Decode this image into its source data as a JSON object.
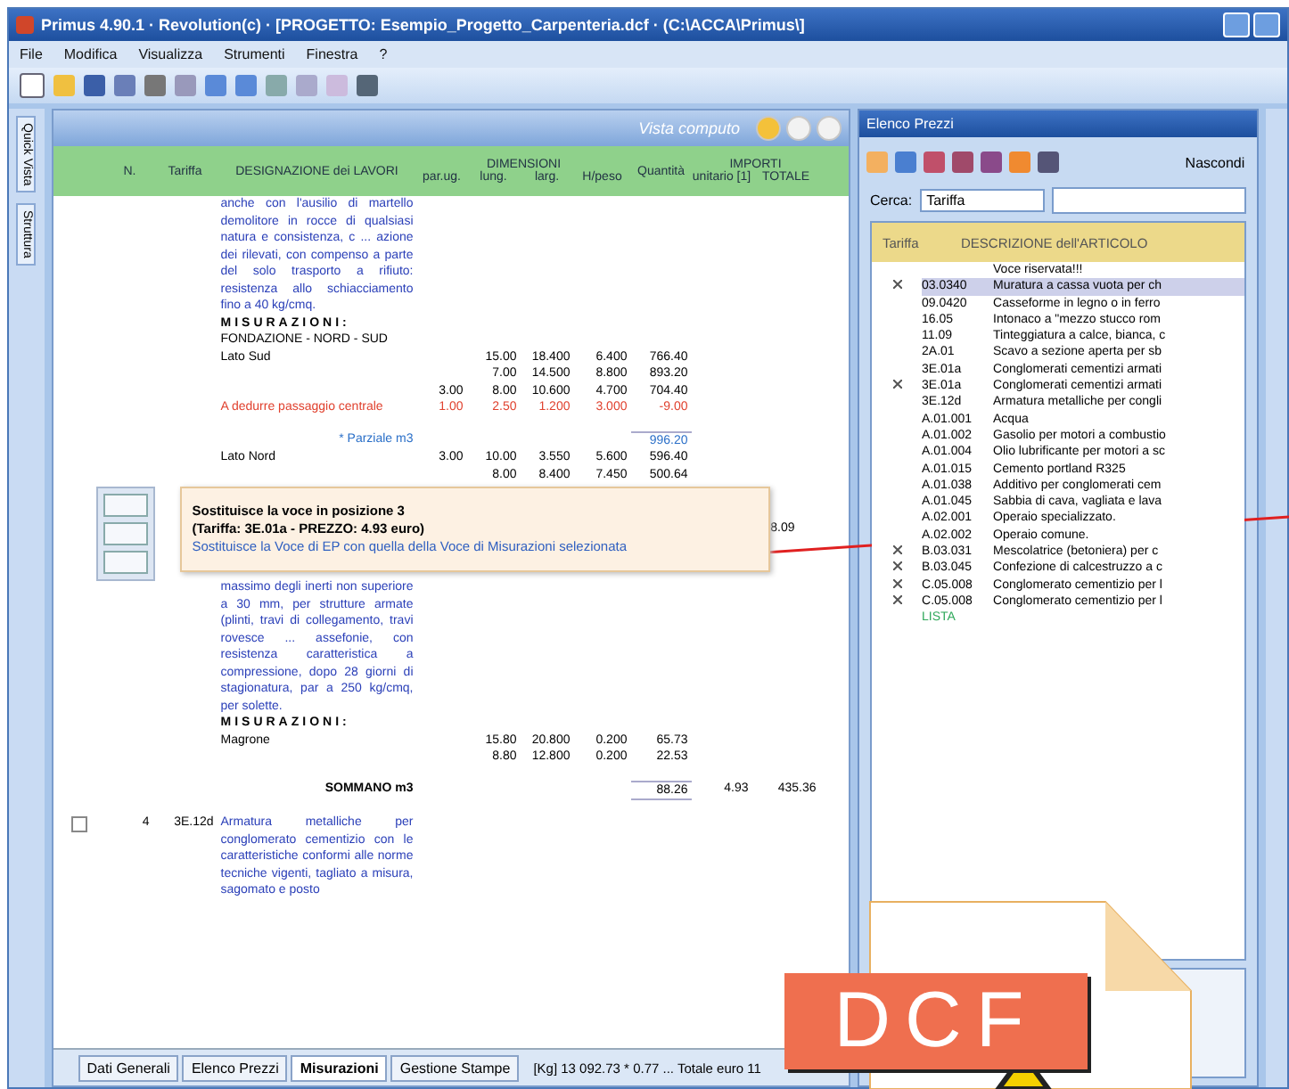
{
  "window": {
    "title": "Primus 4.90.1 · Revolution(c) · [PROGETTO: Esempio_Progetto_Carpenteria.dcf · (C:\\ACCA\\Primus\\]"
  },
  "menu": [
    "File",
    "Modifica",
    "Visualizza",
    "Strumenti",
    "Finestra",
    "?"
  ],
  "side_tabs": [
    "Quick Vista",
    "Struttura"
  ],
  "document": {
    "title": "Vista computo",
    "header": {
      "number": "N.",
      "tariff": "Tariffa",
      "designation": "DESIGNAZIONE dei LAVORI",
      "dimensions": "DIMENSIONI",
      "dim_columns": [
        "par.ug.",
        "lung.",
        "larg.",
        "H/peso"
      ],
      "quantity": "Quantità",
      "amounts": "IMPORTI",
      "amount_columns": [
        "unitario [1]",
        "TOTALE"
      ]
    },
    "rows": [
      {
        "kind": "text",
        "desc": "anche con l'ausilio di martello demolitore in rocce di qualsiasi natura e consistenza, c ... azione dei rilevati, con compenso a parte del solo trasporto a rifiuto: resistenza allo schiacciamento fino a 40 kg/cmq."
      },
      {
        "kind": "heading",
        "desc": "MISURAZIONI:"
      },
      {
        "kind": "measure",
        "desc": "FONDAZIONE - NORD - SUD"
      },
      {
        "kind": "measure",
        "desc": "Lato Sud",
        "lung": "15.00",
        "larg": "18.400",
        "peso": "6.400",
        "qty": "766.40"
      },
      {
        "kind": "measure",
        "lung": "7.00",
        "larg": "14.500",
        "peso": "8.800",
        "qty": "893.20"
      },
      {
        "kind": "measure",
        "par": "3.00",
        "lung": "8.00",
        "larg": "10.600",
        "peso": "4.700",
        "qty": "704.40"
      },
      {
        "kind": "deduct",
        "desc": "A dedurre passaggio centrale",
        "par": "1.00",
        "lung": "2.50",
        "larg": "1.200",
        "peso": "3.000",
        "qty": "-9.00"
      },
      {
        "kind": "partial",
        "desc": "* Parziale m3",
        "qty": "996.20"
      },
      {
        "kind": "measure",
        "desc": "Lato Nord",
        "par": "3.00",
        "lung": "10.00",
        "larg": "3.550",
        "peso": "5.600",
        "qty": "596.40"
      },
      {
        "kind": "measure",
        "lung": "8.00",
        "larg": "8.400",
        "peso": "7.450",
        "qty": "500.64"
      },
      {
        "kind": "tooltip",
        "total": "8.09"
      },
      {
        "kind": "text",
        "desc": "massimo degli inerti non superiore a 30 mm, per strutture armate (plinti, travi di collegamento, travi rovesce ... assefonie, con resistenza caratteristica a compressione, dopo 28 giorni di stagionatura, par a 250 kg/cmq, per solette."
      },
      {
        "kind": "heading",
        "desc": "MISURAZIONI:"
      },
      {
        "kind": "measure",
        "desc": "Magrone",
        "lung": "15.80",
        "larg": "20.800",
        "peso": "0.200",
        "qty": "65.73"
      },
      {
        "kind": "measure",
        "lung": "8.80",
        "larg": "12.800",
        "peso": "0.200",
        "qty": "22.53"
      },
      {
        "kind": "sum",
        "desc": "SOMMANO m3",
        "qty": "88.26",
        "unit": "4.93",
        "total": "435.36"
      },
      {
        "kind": "item",
        "checked": false,
        "num": "4",
        "tariff": "3E.12d",
        "desc": "Armatura metalliche per conglomerato cementizio con le caratteristiche conformi alle norme tecniche vigenti, tagliato a misura, sagomato e posto"
      }
    ],
    "tooltip": {
      "title": "Sostituisce la voce in posizione 3",
      "subtitle": "(Tariffa: 3E.01a - PREZZO: 4.93 euro)",
      "description": "Sostituisce la Voce di EP con quella della Voce di Misurazioni selezionata"
    },
    "tabs": [
      {
        "label": "Dati Generali",
        "selected": false
      },
      {
        "label": "Elenco Prezzi",
        "selected": false
      },
      {
        "label": "Misurazioni",
        "selected": true
      },
      {
        "label": "Gestione Stampe",
        "selected": false
      }
    ],
    "status": "[Kg] 13 092.73 * 0.77 ... Totale euro 11"
  },
  "price_list": {
    "title": "Elenco Prezzi",
    "hide_button": "Nascondi",
    "search_label": "Cerca:",
    "search_field": "Tariffa",
    "columns": [
      "Tariffa",
      "DESCRIZIONE dell'ARTICOLO"
    ],
    "items": [
      {
        "description": "Voce riservata!!!",
        "selected": false,
        "marked": false
      },
      {
        "tariff": "03.0340",
        "description": "Muratura a cassa vuota per ch",
        "selected": true,
        "marked": true
      },
      {
        "tariff": "09.0420",
        "description": "Casseforme in legno o in ferro",
        "selected": false,
        "marked": false
      },
      {
        "tariff": "16.05",
        "description": "Intonaco a \"mezzo stucco rom",
        "selected": false,
        "marked": false
      },
      {
        "tariff": "11.09",
        "description": "Tinteggiatura a calce, bianca, c",
        "selected": false,
        "marked": false
      },
      {
        "tariff": "2A.01",
        "description": "Scavo a sezione aperta per sb",
        "selected": false,
        "marked": false
      },
      {
        "tariff": "3E.01a",
        "description": "Conglomerati cementizi armati",
        "selected": false,
        "marked": false
      },
      {
        "tariff": "3E.01a",
        "description": "Conglomerati cementizi armati",
        "selected": false,
        "marked": true
      },
      {
        "tariff": "3E.12d",
        "description": "Armatura metalliche per congli",
        "selected": false,
        "marked": false
      },
      {
        "tariff": "A.01.001",
        "description": "Acqua",
        "selected": false,
        "marked": false
      },
      {
        "tariff": "A.01.002",
        "description": "Gasolio per motori a combustio",
        "selected": false,
        "marked": false
      },
      {
        "tariff": "A.01.004",
        "description": "Olio lubrificante per motori a sc",
        "selected": false,
        "marked": false
      },
      {
        "tariff": "A.01.015",
        "description": "Cemento portland R325",
        "selected": false,
        "marked": false
      },
      {
        "tariff": "A.01.038",
        "description": "Additivo per conglomerati cem",
        "selected": false,
        "marked": false
      },
      {
        "tariff": "A.01.045",
        "description": "Sabbia di cava, vagliata e lava",
        "selected": false,
        "marked": false
      },
      {
        "tariff": "A.02.001",
        "description": "Operaio specializzato.",
        "selected": false,
        "marked": false
      },
      {
        "tariff": "A.02.002",
        "description": "Operaio comune.",
        "selected": false,
        "marked": false
      },
      {
        "tariff": "B.03.031",
        "description": "Mescolatrice (betoniera) per c",
        "selected": false,
        "marked": true
      },
      {
        "tariff": "B.03.045",
        "description": "Confezione di calcestruzzo a c",
        "selected": false,
        "marked": true
      },
      {
        "tariff": "C.05.008",
        "description": "Conglomerato cementizio per l",
        "selected": false,
        "marked": true
      },
      {
        "tariff": "C.05.008",
        "description": "Conglomerato cementizio per l",
        "selected": false,
        "marked": true
      },
      {
        "tariff": "LISTA",
        "selected": false,
        "marked": false
      }
    ]
  },
  "file_badge": {
    "label": "DCF"
  }
}
